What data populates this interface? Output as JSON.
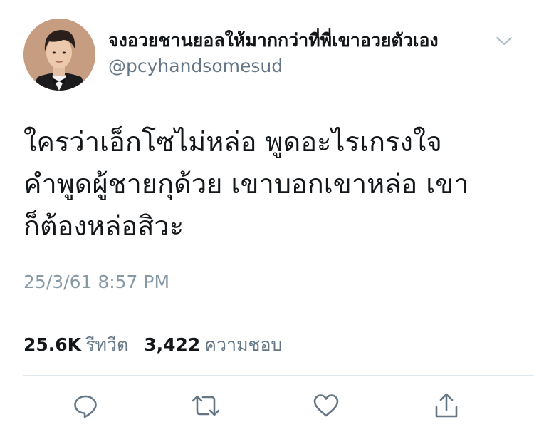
{
  "tweet": {
    "display_name": "จงอวยชานยอลให้มากกว่าที่พี่เขาอวยตัวเอง",
    "handle": "@pcyhandsomesud",
    "text_lines": [
      "ใครว่าเอ็กโซไม่หล่อ พูดอะไรเกรงใจ",
      "คำพูดผู้ชายกุด้วย เขาบอกเขาหล่อ เขา",
      "ก็ต้องหล่อสิวะ"
    ],
    "timestamp": "25/3/61 8:57 PM",
    "stats": {
      "retweets_count": "25.6K",
      "retweets_label": "รีทวีต",
      "likes_count": "3,422",
      "likes_label": "ความชอบ"
    }
  },
  "icons": {
    "menu": "chevron-down-icon",
    "reply": "reply-icon",
    "retweet": "retweet-icon",
    "like": "heart-icon",
    "share": "share-icon"
  },
  "colors": {
    "text_primary": "#14171a",
    "text_secondary": "#657786",
    "timestamp": "#8899a6",
    "icon": "#657786",
    "divider": "#e1e8ed"
  }
}
